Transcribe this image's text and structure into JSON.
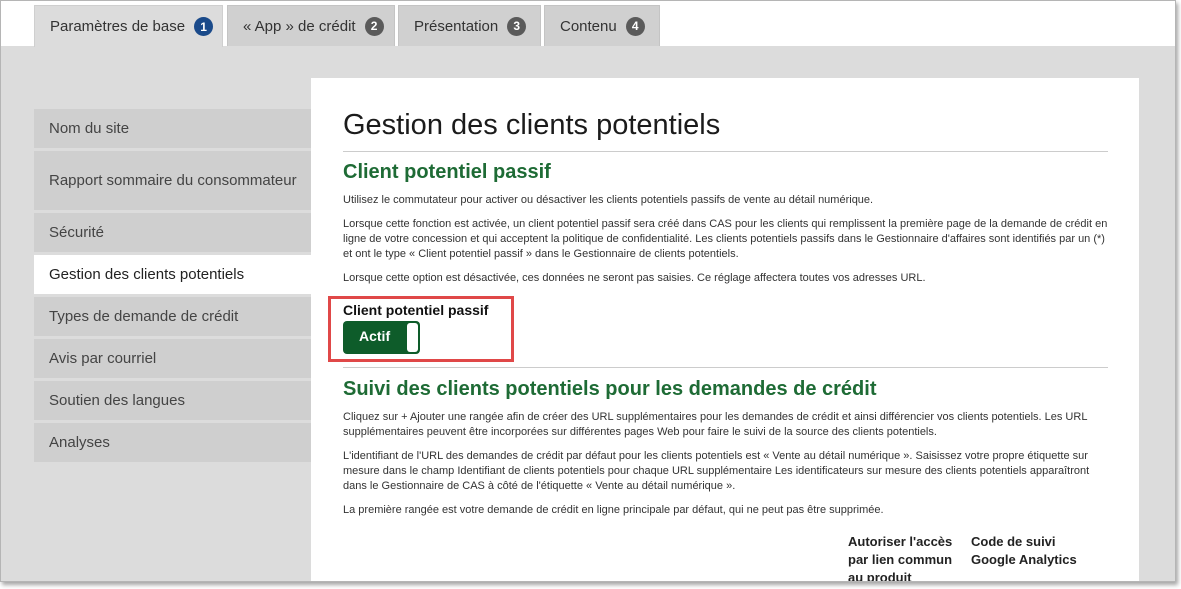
{
  "tabs": [
    {
      "label": "Paramètres de base",
      "num": "1"
    },
    {
      "label": "« App » de crédit",
      "num": "2"
    },
    {
      "label": "Présentation",
      "num": "3"
    },
    {
      "label": "Contenu",
      "num": "4"
    }
  ],
  "sidebar": {
    "items": [
      "Nom du site",
      "Rapport sommaire du consommateur",
      "Sécurité",
      "Gestion des clients potentiels",
      "Types de demande de crédit",
      "Avis par courriel",
      "Soutien des langues",
      "Analyses"
    ]
  },
  "main": {
    "title": "Gestion des clients potentiels",
    "passive": {
      "heading": "Client potentiel passif",
      "p1": "Utilisez le commutateur pour activer ou désactiver les clients potentiels passifs de vente au détail numérique.",
      "p2": "Lorsque cette fonction est activée, un client potentiel passif sera créé dans CAS pour les clients qui remplissent la première page de la demande de crédit en ligne de votre concession et qui acceptent la politique de confidentialité. Les clients potentiels passifs dans le Gestionnaire d'affaires sont identifiés par un (*) et ont le type « Client potentiel passif » dans le Gestionnaire de clients potentiels.",
      "p3": "Lorsque cette option est désactivée, ces données ne seront pas saisies. Ce réglage affectera toutes vos adresses URL.",
      "toggle_label": "Client potentiel passif",
      "toggle_state": "Actif"
    },
    "tracking": {
      "heading": "Suivi des clients potentiels pour les demandes de crédit",
      "p1": "Cliquez sur + Ajouter une rangée afin de créer des URL supplémentaires pour les demandes de crédit et ainsi différencier vos clients potentiels. Les URL supplémentaires peuvent être incorporées sur différentes pages Web pour faire le suivi de la source des clients potentiels.",
      "p2": "L'identifiant de l'URL des demandes de crédit par défaut pour les clients potentiels est « Vente au détail numérique ». Saisissez votre propre étiquette sur mesure dans le champ Identifiant de clients potentiels pour chaque URL supplémentaire Les identificateurs sur mesure des clients potentiels apparaîtront dans le Gestionnaire de CAS à côté de l'étiquette « Vente au détail numérique ».",
      "p3": "La première rangée est votre demande de crédit en ligne principale par défaut, qui ne peut pas être supprimée.",
      "col1": "Autoriser l'accès par lien commun au produit",
      "col2": "Code de suivi Google Analytics"
    }
  }
}
